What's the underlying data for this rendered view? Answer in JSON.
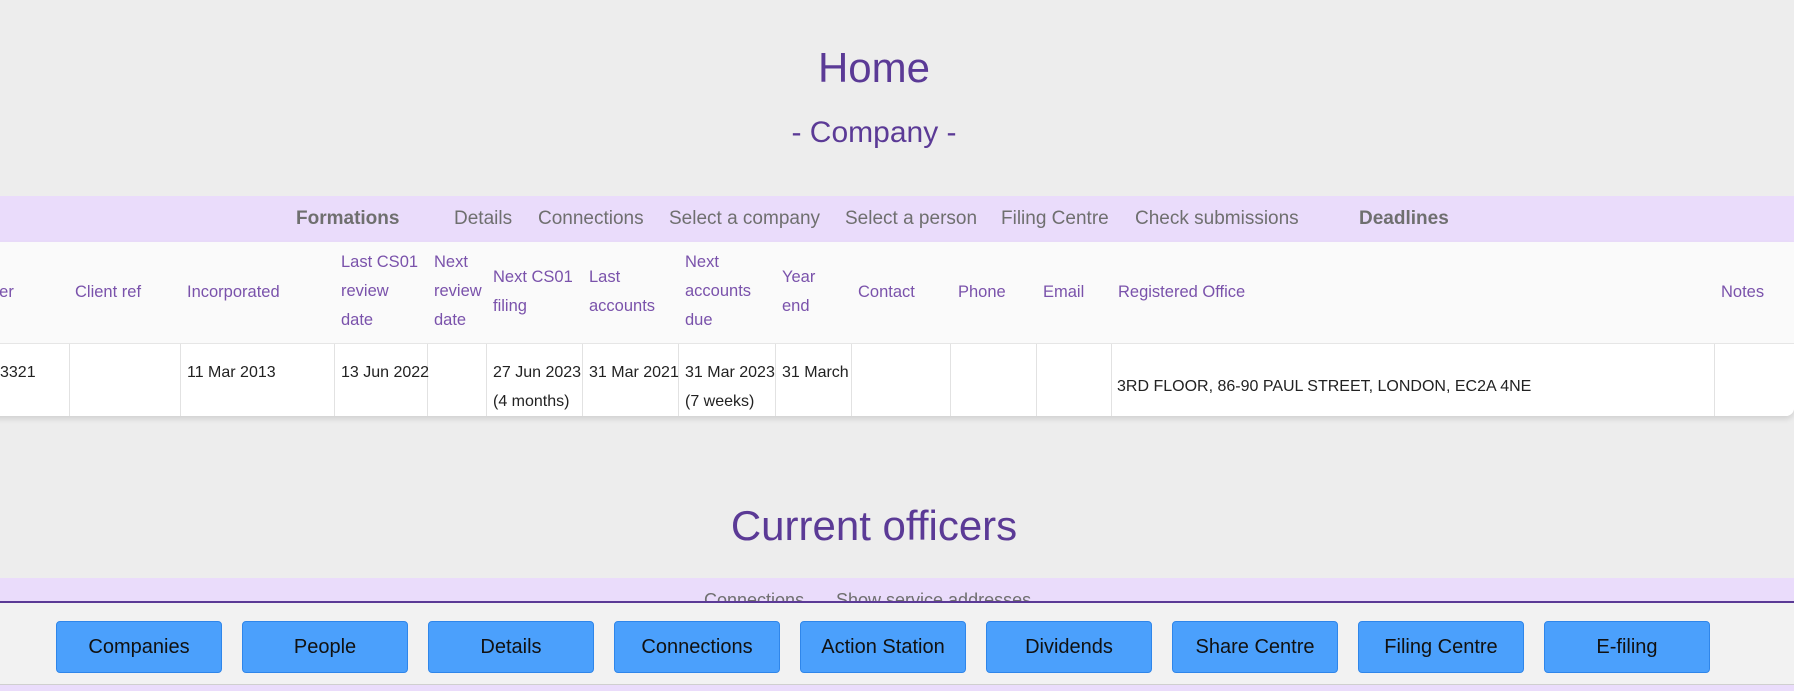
{
  "page": {
    "title": "Home",
    "subtitle": "- Company -"
  },
  "tabs": [
    "Formations",
    "Details",
    "Connections",
    "Select a company",
    "Select a person",
    "Filing Centre",
    "Check submissions",
    "Deadlines"
  ],
  "table": {
    "headers": {
      "number": "ber",
      "client_ref": "Client ref",
      "incorporated": "Incorporated",
      "last_cs01": [
        "Last CS01",
        "review",
        "date"
      ],
      "next_review": [
        "Next",
        "review",
        "date"
      ],
      "next_cs01": [
        "Next CS01",
        "filing"
      ],
      "last_accounts": [
        "Last",
        "accounts"
      ],
      "next_accounts": [
        "Next",
        "accounts",
        "due"
      ],
      "year_end": [
        "Year",
        "end"
      ],
      "contact": "Contact",
      "phone": "Phone",
      "email": "Email",
      "registered_office": "Registered Office",
      "notes": "Notes"
    },
    "row": {
      "number": "3321",
      "client_ref": "",
      "incorporated": "11 Mar 2013",
      "last_cs01": "13 Jun 2022",
      "next_review": "",
      "next_cs01": [
        "27 Jun 2023",
        "(4 months)"
      ],
      "last_accounts": "31 Mar 2021",
      "next_accounts": [
        "31 Mar 2023",
        "(7 weeks)"
      ],
      "year_end": "31 March",
      "contact": "",
      "phone": "",
      "email": "",
      "registered_office": "3RD FLOOR, 86-90 PAUL STREET, LONDON, EC2A 4NE",
      "notes": ""
    }
  },
  "officers": {
    "title": "Current officers",
    "tabs": [
      "Connections",
      "Show service addresses"
    ]
  },
  "bottom_nav": [
    "Companies",
    "People",
    "Details",
    "Connections",
    "Action Station",
    "Dividends",
    "Share Centre",
    "Filing Centre",
    "E-filing"
  ],
  "colors": {
    "accent": "#5b3a96",
    "tab_bg": "#eadcfb",
    "button": "#4ba0fc"
  }
}
